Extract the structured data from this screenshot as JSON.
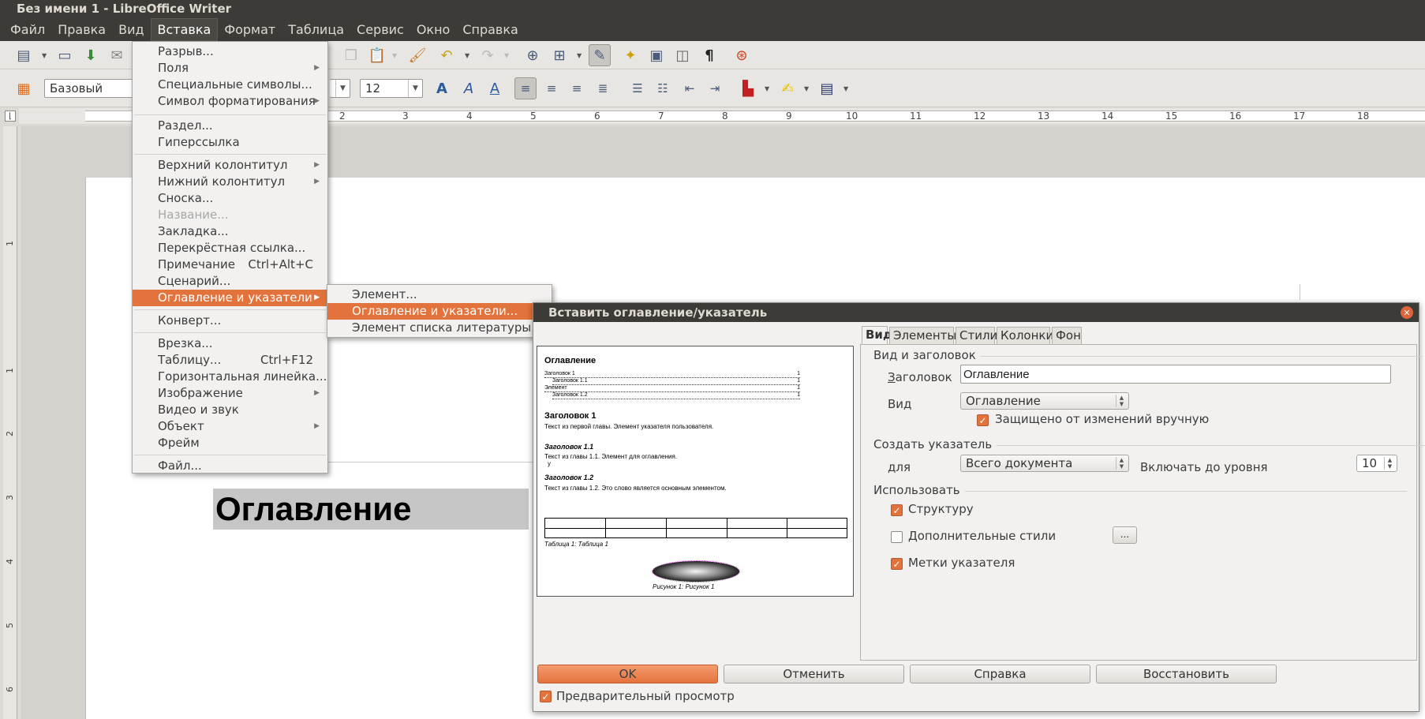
{
  "window": {
    "title": "Без имени 1 - LibreOffice Writer"
  },
  "menubar": [
    {
      "label": "Файл",
      "name": "menu-file"
    },
    {
      "label": "Правка",
      "name": "menu-edit"
    },
    {
      "label": "Вид",
      "name": "menu-view"
    },
    {
      "label": "Вставка",
      "name": "menu-insert"
    },
    {
      "label": "Формат",
      "name": "menu-format"
    },
    {
      "label": "Таблица",
      "name": "menu-table"
    },
    {
      "label": "Сервис",
      "name": "menu-tools"
    },
    {
      "label": "Окно",
      "name": "menu-window"
    },
    {
      "label": "Справка",
      "name": "menu-help"
    }
  ],
  "format_toolbar": {
    "style": "Базовый",
    "font_size": "12"
  },
  "ruler": {
    "h_numbers": [
      "2",
      "3",
      "4",
      "5",
      "6",
      "7",
      "8",
      "9",
      "10",
      "11",
      "12",
      "13",
      "14",
      "15",
      "16",
      "17",
      "18"
    ],
    "v_numbers": [
      "1",
      "1",
      "2",
      "3",
      "4",
      "5",
      "6"
    ]
  },
  "document": {
    "heading": "Оглавление"
  },
  "insert_menu": {
    "items": [
      {
        "label": "Разрыв...",
        "shortcut": "",
        "submenu": false,
        "disabled": false
      },
      {
        "label": "Поля",
        "shortcut": "",
        "submenu": true,
        "disabled": false
      },
      {
        "label": "Специальные символы...",
        "shortcut": "",
        "submenu": false,
        "disabled": false
      },
      {
        "label": "Символ форматирования",
        "shortcut": "",
        "submenu": true,
        "disabled": false
      },
      {
        "label": "Раздел...",
        "shortcut": "",
        "submenu": false,
        "disabled": false
      },
      {
        "label": "Гиперссылка",
        "shortcut": "",
        "submenu": false,
        "disabled": false
      },
      {
        "label": "Верхний колонтитул",
        "shortcut": "",
        "submenu": true,
        "disabled": false
      },
      {
        "label": "Нижний колонтитул",
        "shortcut": "",
        "submenu": true,
        "disabled": false
      },
      {
        "label": "Сноска...",
        "shortcut": "",
        "submenu": false,
        "disabled": false
      },
      {
        "label": "Название...",
        "shortcut": "",
        "submenu": false,
        "disabled": true
      },
      {
        "label": "Закладка...",
        "shortcut": "",
        "submenu": false,
        "disabled": false
      },
      {
        "label": "Перекрёстная ссылка...",
        "shortcut": "",
        "submenu": false,
        "disabled": false
      },
      {
        "label": "Примечание",
        "shortcut": "Ctrl+Alt+C",
        "submenu": false,
        "disabled": false
      },
      {
        "label": "Сценарий...",
        "shortcut": "",
        "submenu": false,
        "disabled": false
      },
      {
        "label": "Оглавление и указатели",
        "shortcut": "",
        "submenu": true,
        "disabled": false,
        "highlighted": true
      },
      {
        "label": "Конверт...",
        "shortcut": "",
        "submenu": false,
        "disabled": false
      },
      {
        "label": "Врезка...",
        "shortcut": "",
        "submenu": false,
        "disabled": false
      },
      {
        "label": "Таблицу...",
        "shortcut": "Ctrl+F12",
        "submenu": false,
        "disabled": false
      },
      {
        "label": "Горизонтальная линейка...",
        "shortcut": "",
        "submenu": false,
        "disabled": false
      },
      {
        "label": "Изображение",
        "shortcut": "",
        "submenu": true,
        "disabled": false
      },
      {
        "label": "Видео и звук",
        "shortcut": "",
        "submenu": false,
        "disabled": false
      },
      {
        "label": "Объект",
        "shortcut": "",
        "submenu": true,
        "disabled": false
      },
      {
        "label": "Фрейм",
        "shortcut": "",
        "submenu": false,
        "disabled": false
      },
      {
        "label": "Файл...",
        "shortcut": "",
        "submenu": false,
        "disabled": false
      }
    ]
  },
  "toc_submenu": {
    "items": [
      {
        "label": "Элемент...",
        "highlighted": false
      },
      {
        "label": "Оглавление и указатели...",
        "highlighted": true
      },
      {
        "label": "Элемент списка литературы...",
        "highlighted": false
      }
    ]
  },
  "dialog": {
    "title": "Вставить оглавление/указатель",
    "tabs": [
      "Вид",
      "Элементы",
      "Стили",
      "Колонки",
      "Фон"
    ],
    "active_tab": "Вид",
    "section_type": "Вид и заголовок",
    "title_label": "Заголовок",
    "title_value": "Оглавление",
    "type_label": "Вид",
    "type_value": "Оглавление",
    "protected_label": "Защищено от изменений вручную",
    "protected_checked": true,
    "section_create": "Создать указатель",
    "for_label": "для",
    "for_value": "Всего документа",
    "levels_label": "Включать до уровня",
    "levels_value": "10",
    "section_use": "Использовать",
    "use_structure": "Структуру",
    "use_structure_checked": true,
    "use_extra_styles": "Дополнительные стили",
    "use_extra_styles_checked": false,
    "extra_styles_button": "...",
    "use_index_marks": "Метки указателя",
    "use_index_marks_checked": true,
    "buttons": {
      "ok": "OK",
      "cancel": "Отменить",
      "help": "Справка",
      "reset": "Восстановить"
    },
    "preview_label": "Предварительный просмотр",
    "preview_checked": true,
    "preview": {
      "toc_title": "Оглавление",
      "toc_lines": [
        {
          "text": "Заголовок 1",
          "page": "1",
          "indent": 0
        },
        {
          "text": "Заголовок 1.1",
          "page": "1",
          "indent": 1
        },
        {
          "text": "Элемент",
          "page": "1",
          "indent": 0
        },
        {
          "text": "Заголовок 1.2",
          "page": "1",
          "indent": 1
        }
      ],
      "h1": "Заголовок 1",
      "h1_text": "Текст из первой главы. Элемент указателя пользователя.",
      "h11": "Заголовок 1.1",
      "h11_text": "Текст из главы 1.1. Элемент для оглавления.",
      "h11_extra": "у",
      "h12": "Заголовок 1.2",
      "h12_text": "Текст из главы 1.2. Это слово является основным элементом.",
      "table_caption": "Таблица 1: Таблица 1",
      "image_caption": "Рисунок 1: Рисунок 1"
    }
  }
}
